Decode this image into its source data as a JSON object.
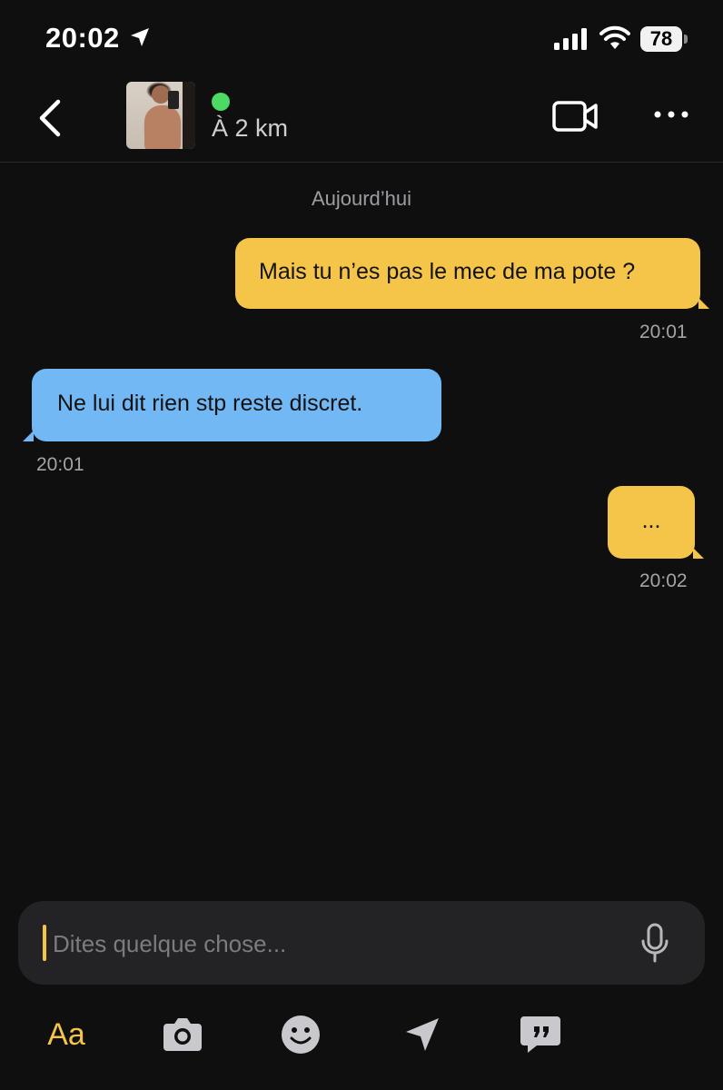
{
  "status_bar": {
    "time": "20:02",
    "battery": "78"
  },
  "header": {
    "distance": "À 2 km",
    "online_color": "#4cd964"
  },
  "chat": {
    "date_label": "Aujourd’hui",
    "messages": [
      {
        "direction": "outgoing",
        "text": "Mais tu n’es pas le mec de ma pote ?",
        "time": "20:01"
      },
      {
        "direction": "incoming",
        "text": "Ne lui dit rien stp reste discret.",
        "time": "20:01"
      },
      {
        "direction": "outgoing",
        "text": "...",
        "time": "20:02"
      }
    ]
  },
  "composer": {
    "placeholder": "Dites quelque chose..."
  },
  "toolbar": {
    "text_style_label": "Aa"
  },
  "colors": {
    "outgoing_bubble": "#f5c54a",
    "incoming_bubble": "#72b8f4",
    "background": "#0f0f10",
    "accent": "#f5c54a"
  },
  "icons": [
    "location-arrow-icon",
    "signal-icon",
    "wifi-icon",
    "battery-icon",
    "back-chevron-icon",
    "video-camera-icon",
    "more-dots-icon",
    "microphone-icon",
    "camera-icon",
    "emoji-icon",
    "send-location-icon",
    "saved-phrases-icon"
  ]
}
